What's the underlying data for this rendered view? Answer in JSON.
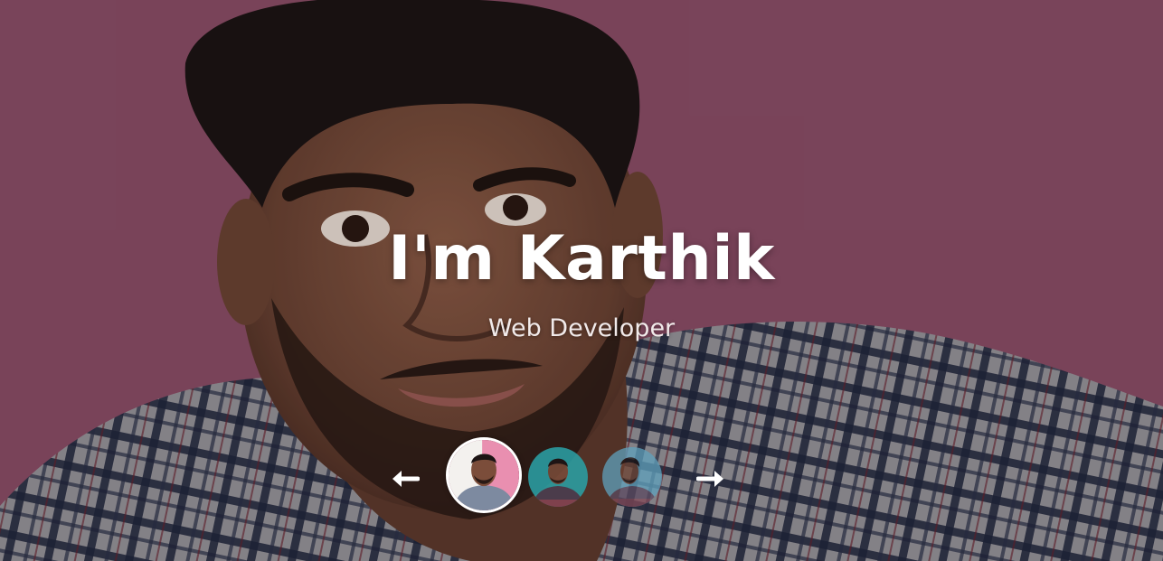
{
  "hero": {
    "headline": "I'm Karthik",
    "subtitle": "Web Developer"
  },
  "carousel": {
    "prev_icon": "arrow-left-icon",
    "next_icon": "arrow-right-icon",
    "thumbnails": [
      {
        "label": "profile-photo-1",
        "bg": "#e98fb0"
      },
      {
        "label": "profile-photo-2",
        "bg": "#2aa3a8"
      },
      {
        "label": "profile-photo-3",
        "bg": "#5fa1bd"
      }
    ]
  },
  "colors": {
    "background": "#8a4d66",
    "text": "#ffffff"
  }
}
